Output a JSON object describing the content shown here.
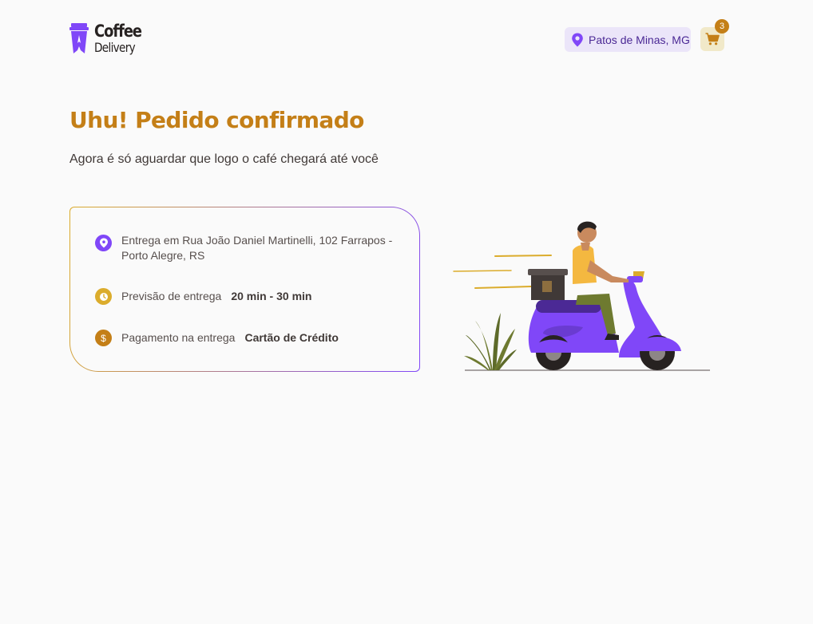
{
  "header": {
    "logo": {
      "line1": "Coffee",
      "line2": "Delivery"
    },
    "location": {
      "label": "Patos de Minas, MG",
      "icon": "map-pin-icon"
    },
    "cart": {
      "icon": "shopping-cart-icon",
      "count": "3"
    }
  },
  "main": {
    "title": "Uhu! Pedido confirmado",
    "subtitle": "Agora é só aguardar que logo o café chegará até você"
  },
  "order_info": {
    "address": {
      "icon": "map-pin-icon",
      "text": "Entrega em Rua João Daniel Martinelli, 102 Farrapos - Porto Alegre, RS"
    },
    "delivery_time": {
      "icon": "timer-icon",
      "label": "Previsão de entrega",
      "value": "20 min - 30 min"
    },
    "payment": {
      "icon": "currency-dollar-icon",
      "label": "Pagamento na entrega",
      "value": "Cartão de Crédito"
    }
  },
  "colors": {
    "brand_yellow_dark": "#C47F17",
    "brand_yellow": "#DBAC2C",
    "brand_purple": "#8047F8",
    "brand_purple_dark": "#4B2995",
    "purple_light": "#EBE5F9",
    "yellow_light": "#F1E9C9",
    "background": "#FAFAFA"
  }
}
